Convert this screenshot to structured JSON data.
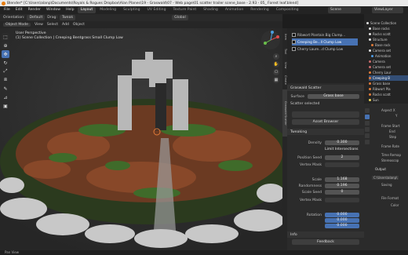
{
  "window": {
    "title": "Blender* [C:\\Users\\alanp\\Documents\\Royals & Rogues Dropbox\\Alan Planes\\19 - Graswald\\07 - Web page\\01 scatter trailer scene_base - 2.93 - 05_ Forest leaf.blend]"
  },
  "menu": [
    "File",
    "Edit",
    "Render",
    "Window",
    "Help"
  ],
  "workspaces": [
    {
      "label": "Layout",
      "active": true
    },
    {
      "label": "Modeling",
      "active": false
    },
    {
      "label": "Sculpting",
      "active": false
    },
    {
      "label": "UV Editing",
      "active": false
    },
    {
      "label": "Texture Paint",
      "active": false
    },
    {
      "label": "Shading",
      "active": false
    },
    {
      "label": "Animation",
      "active": false
    },
    {
      "label": "Rendering",
      "active": false
    },
    {
      "label": "Compositing",
      "active": false
    }
  ],
  "scene": {
    "name": "Scene",
    "view_layer": "ViewLayer"
  },
  "header": {
    "orientation_label": "Orientation:",
    "orientation_value": "Default",
    "drag_label": "Drag:",
    "drag_value": "Tweak",
    "transform": "Global"
  },
  "header2": {
    "mode": "Object Mode",
    "menus": [
      "View",
      "Select",
      "Add",
      "Object"
    ]
  },
  "viewport": {
    "perspective": "User Perspective",
    "collection": "(1) Scene Collection | Creeping Bentgrass Small Clump Low"
  },
  "side_tabs": [
    "Item",
    "Tool",
    "View",
    "Create",
    "Graswald Scatter"
  ],
  "assets": [
    {
      "label": "Ribwort Plantain Big Clump...",
      "selected": false
    },
    {
      "label": "Creeping Be...ll Clump Low",
      "selected": true
    },
    {
      "label": "Cherry Laure...d Clump Low",
      "selected": false
    }
  ],
  "panel": {
    "title": "Graswald Scatter",
    "surface_label": "Surface",
    "surface_value": "Grass base",
    "scatter_selected": "Scatter selected",
    "asset_browser": "Asset Browser",
    "tweaking": "Tweaking",
    "density_label": "Density",
    "density_value": "0.300",
    "limit_intersections": "Limit Intersections",
    "position_seed_label": "Position Seed",
    "position_seed_value": "2",
    "vertex_mask_label": "Vertex Mask",
    "scale_label": "Scale",
    "scale_value": "1.168",
    "randomness_label": "Randomness",
    "randomness_value": "0.196",
    "scale_seed_label": "Scale Seed",
    "scale_seed_value": "0",
    "vertex_mask2_label": "Vertex Mask",
    "rotation_label": "Rotation",
    "rotation_values": [
      "0.000",
      "0.000",
      "0.000"
    ],
    "info": "Info",
    "feedback": "Feedback"
  },
  "outliner": [
    {
      "label": "Scene Collection",
      "color": "#dddddd"
    },
    {
      "label": "Base rocks",
      "color": "#e0e0e0"
    },
    {
      "label": "Rocks scatt",
      "color": "#e0e0e0"
    },
    {
      "label": "Structure",
      "color": "#e0e0e0"
    },
    {
      "label": "Base rock",
      "color": "#e07b39"
    },
    {
      "label": "Camera set",
      "color": "#e0e0e0"
    },
    {
      "label": "Animation",
      "color": "#4e9ce6"
    },
    {
      "label": "Camera",
      "color": "#c86b6b"
    },
    {
      "label": "Camera set",
      "color": "#c86b6b"
    },
    {
      "label": "Cherry Laur",
      "color": "#e07b39"
    },
    {
      "label": "Creeping B",
      "color": "#e07b39"
    },
    {
      "label": "Grass base",
      "color": "#e07b39"
    },
    {
      "label": "Ribwort Pla",
      "color": "#e07b39"
    },
    {
      "label": "Rocks scatt",
      "color": "#e07b39"
    },
    {
      "label": "Sun",
      "color": "#e8d35a"
    }
  ],
  "right_props": [
    "Aspect X",
    "Y",
    "Frame Start",
    "End",
    "Step",
    "Frame Rate",
    "Time Remap",
    "Stereoscop",
    "Output",
    "C:\\Users\\alanp\\",
    "Saving",
    "File Format",
    "Color"
  ],
  "status": {
    "text": "Pan View"
  }
}
